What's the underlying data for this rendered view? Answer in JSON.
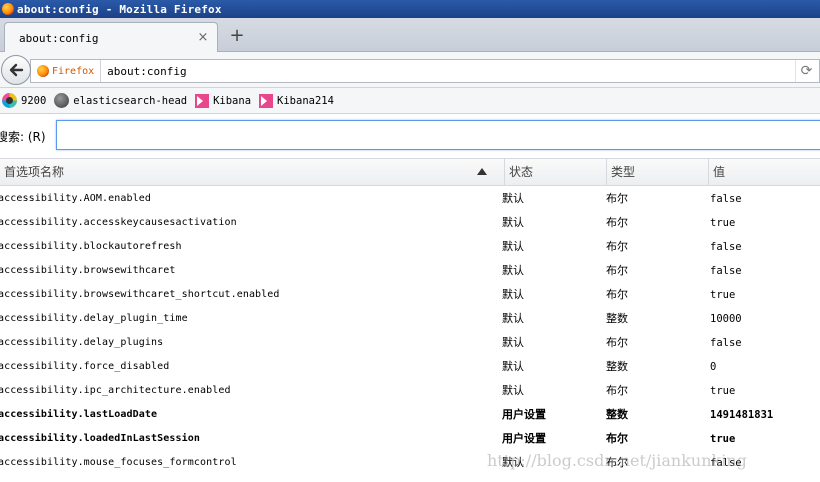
{
  "window": {
    "title": "about:config - Mozilla Firefox"
  },
  "tab": {
    "label": "about:config",
    "close": "×"
  },
  "newtab": {
    "label": "+"
  },
  "navbar": {
    "identity_label": "Firefox",
    "url": "about:config",
    "reload": "⟳"
  },
  "bookmarks": [
    {
      "label": "9200",
      "icon": "elasticsearch-icon"
    },
    {
      "label": "elasticsearch-head",
      "icon": "globe-icon"
    },
    {
      "label": "Kibana",
      "icon": "kibana-icon"
    },
    {
      "label": "Kibana214",
      "icon": "kibana-icon"
    }
  ],
  "search": {
    "label": "搜索: (R)",
    "value": ""
  },
  "table": {
    "headers": {
      "name": "首选项名称",
      "state": "状态",
      "type": "类型",
      "value": "值"
    },
    "rows": [
      {
        "name": "accessibility.AOM.enabled",
        "state": "默认",
        "type": "布尔",
        "value": "false"
      },
      {
        "name": "accessibility.accesskeycausesactivation",
        "state": "默认",
        "type": "布尔",
        "value": "true"
      },
      {
        "name": "accessibility.blockautorefresh",
        "state": "默认",
        "type": "布尔",
        "value": "false"
      },
      {
        "name": "accessibility.browsewithcaret",
        "state": "默认",
        "type": "布尔",
        "value": "false"
      },
      {
        "name": "accessibility.browsewithcaret_shortcut.enabled",
        "state": "默认",
        "type": "布尔",
        "value": "true"
      },
      {
        "name": "accessibility.delay_plugin_time",
        "state": "默认",
        "type": "整数",
        "value": "10000"
      },
      {
        "name": "accessibility.delay_plugins",
        "state": "默认",
        "type": "布尔",
        "value": "false"
      },
      {
        "name": "accessibility.force_disabled",
        "state": "默认",
        "type": "整数",
        "value": "0"
      },
      {
        "name": "accessibility.ipc_architecture.enabled",
        "state": "默认",
        "type": "布尔",
        "value": "true"
      },
      {
        "name": "accessibility.lastLoadDate",
        "state": "用户设置",
        "type": "整数",
        "value": "1491481831"
      },
      {
        "name": "accessibility.loadedInLastSession",
        "state": "用户设置",
        "type": "布尔",
        "value": "true"
      },
      {
        "name": "accessibility.mouse_focuses_formcontrol",
        "state": "默认",
        "type": "布尔",
        "value": "false"
      }
    ]
  },
  "watermark": "http://blog.csdn.net/jiankunking"
}
